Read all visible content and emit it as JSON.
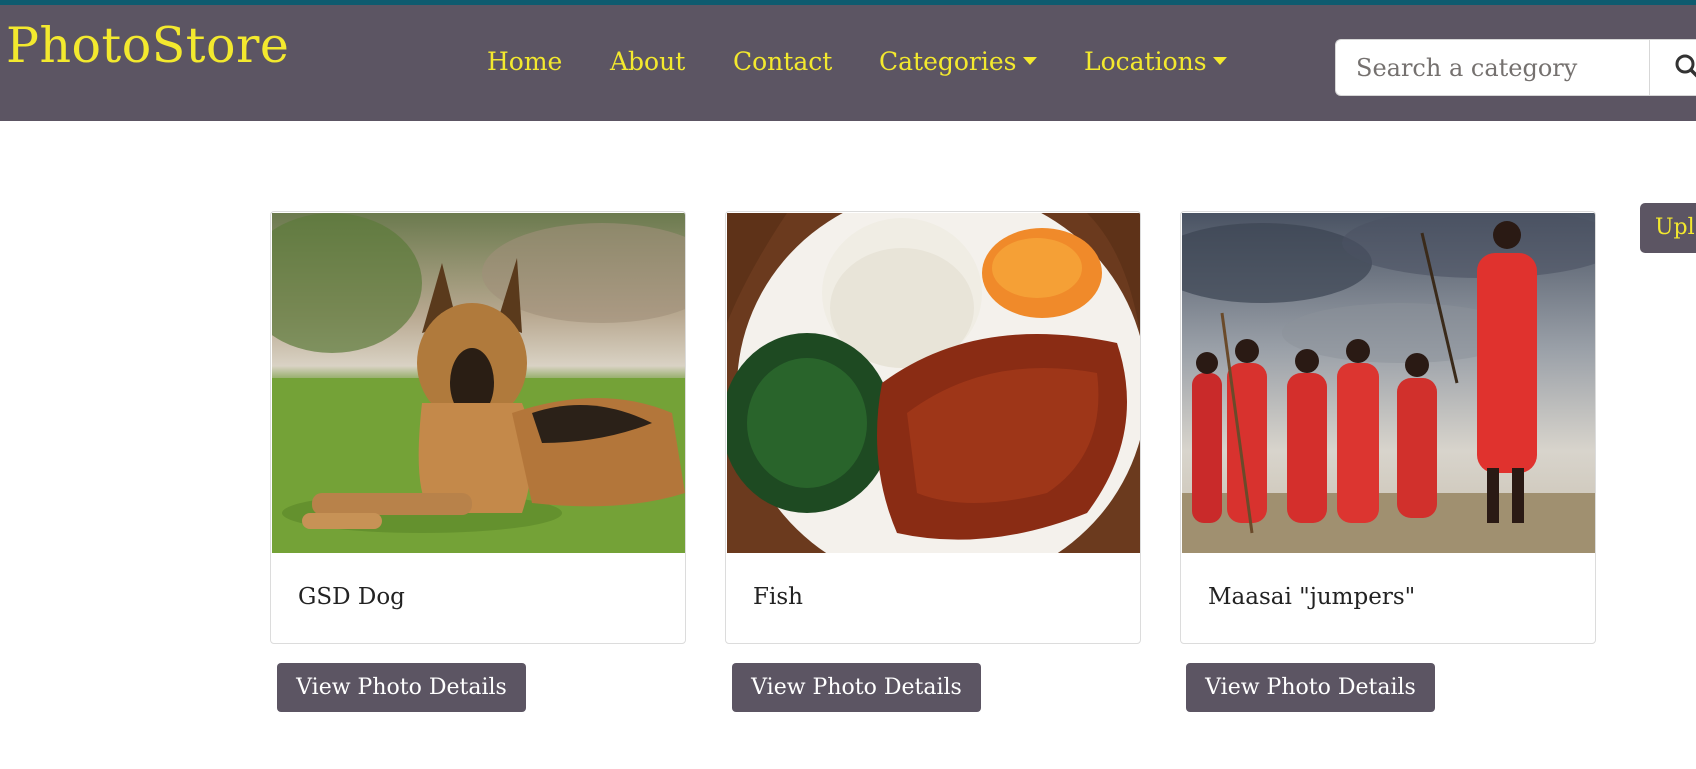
{
  "colors": {
    "navbar_bg": "#5c5563",
    "accent_yellow": "#f3e92e",
    "top_border": "#0e5b6f",
    "button_bg": "#5c5563"
  },
  "navbar": {
    "brand": "PhotoStore",
    "links": [
      {
        "label": "Home"
      },
      {
        "label": "About"
      },
      {
        "label": "Contact"
      },
      {
        "label": "Categories",
        "dropdown": true
      },
      {
        "label": "Locations",
        "dropdown": true
      }
    ],
    "search": {
      "placeholder": "Search a category",
      "value": "",
      "icon": "search-icon"
    }
  },
  "upload_button": {
    "label": "Upl"
  },
  "photos": [
    {
      "title": "GSD Dog",
      "image": "german-shepherd-dog-photo",
      "button_label": "View Photo Details"
    },
    {
      "title": "Fish",
      "image": "fish-ugali-sukuma-plate-photo",
      "button_label": "View Photo Details"
    },
    {
      "title": "Maasai \"jumpers\"",
      "image": "maasai-warriors-jumping-photo",
      "button_label": "View Photo Details"
    }
  ]
}
